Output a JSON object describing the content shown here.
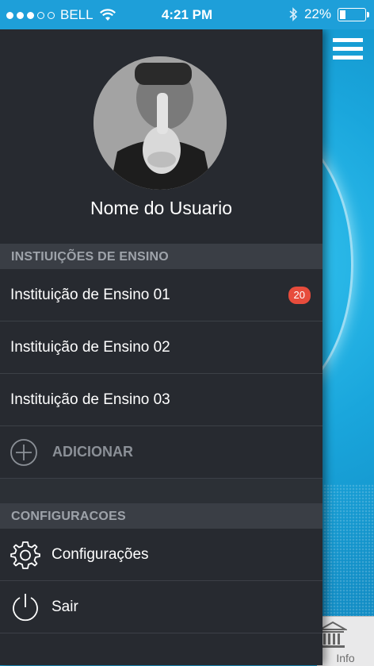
{
  "status_bar": {
    "carrier": "BELL",
    "time": "4:21 PM",
    "battery": "22%",
    "battery_level": 0.22,
    "signal_dots_filled": 3,
    "signal_dots_total": 5
  },
  "drawer": {
    "user_name": "Nome do Usuario",
    "sections": {
      "institutions_header": "INSTIUIÇÕES DE ENSINO",
      "settings_header": "CONFIGURACOES"
    },
    "institutions": [
      {
        "label": "Instituição de Ensino 01",
        "badge": "20"
      },
      {
        "label": "Instituição de Ensino 02"
      },
      {
        "label": "Instituição de Ensino 03"
      }
    ],
    "add_label": "ADICIONAR",
    "settings_label": "Configurações",
    "logout_label": "Sair"
  },
  "tabbar": {
    "info_label": "Info"
  },
  "colors": {
    "drawer_bg": "#272a30",
    "section_bg": "#3a3e45",
    "badge": "#e74c3c",
    "accent_blue": "#1aa0d6"
  }
}
